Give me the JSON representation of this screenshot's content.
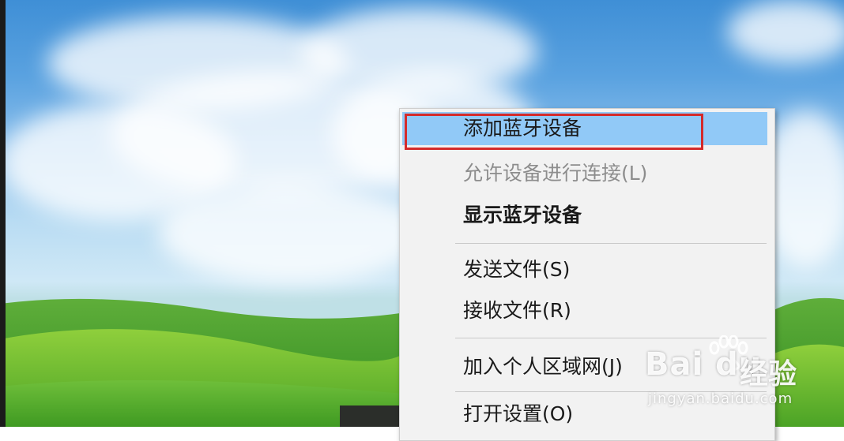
{
  "context_menu": {
    "items": [
      {
        "label": "添加蓝牙设备",
        "state": "hover"
      },
      {
        "label": "允许设备进行连接(L)",
        "state": "disabled"
      },
      {
        "label": "显示蓝牙设备",
        "state": "default-bold"
      },
      {
        "label": "发送文件(S)",
        "state": "normal"
      },
      {
        "label": "接收文件(R)",
        "state": "normal"
      },
      {
        "label": "加入个人区域网(J)",
        "state": "normal"
      },
      {
        "label": "打开设置(O)",
        "state": "normal"
      }
    ]
  },
  "annotation": {
    "color": "#d42a2a"
  },
  "watermark": {
    "logo_text": "Bai du",
    "cn_text": "经验",
    "url": "jingyan.baidu.com"
  },
  "colors": {
    "menu_background": "#f2f2f2",
    "hover_highlight": "#91c9f7",
    "disabled_text": "#8d8d8d"
  }
}
